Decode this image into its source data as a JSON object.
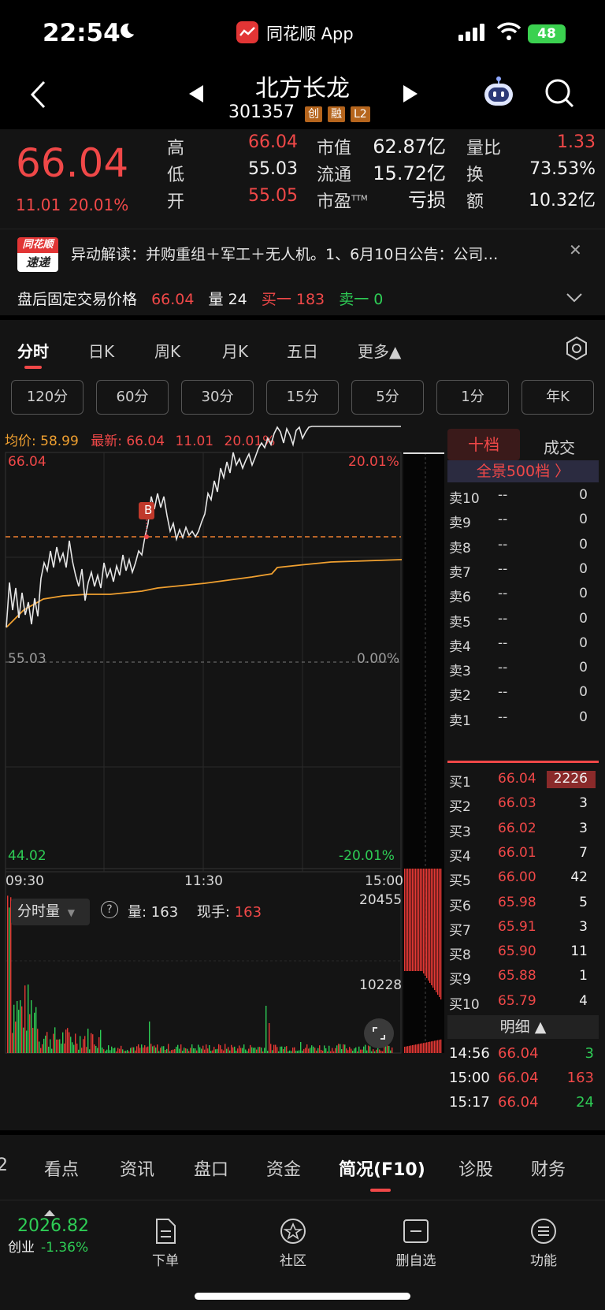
{
  "status": {
    "time": "22:54",
    "app": "同花顺 App",
    "battery": "48"
  },
  "nav": {
    "name": "北方长龙",
    "code": "301357",
    "tags": [
      "创",
      "融",
      "L2"
    ]
  },
  "quote": {
    "price": "66.04",
    "change": "11.01",
    "pct": "20.01%",
    "stats": [
      {
        "label": "高",
        "value": "66.04",
        "color": "#f04848"
      },
      {
        "label": "低",
        "value": "55.03",
        "color": "#e8e8e8"
      },
      {
        "label": "开",
        "value": "55.05",
        "color": "#f04848"
      },
      {
        "label": "市值",
        "value": "62.87亿",
        "color": "#e8e8e8"
      },
      {
        "label": "流通",
        "value": "15.72亿",
        "color": "#e8e8e8"
      },
      {
        "label": "市盈",
        "value": "亏损",
        "color": "#e8e8e8",
        "sup": "TTM"
      },
      {
        "label": "量比",
        "value": "1.33",
        "color": "#f04848"
      },
      {
        "label": "换",
        "value": "73.53%",
        "color": "#e8e8e8"
      },
      {
        "label": "额",
        "value": "10.32亿",
        "color": "#e8e8e8"
      }
    ]
  },
  "news": {
    "logo_top": "同花顺",
    "logo_bottom": "速递",
    "text": "异动解读：并购重组＋军工＋无人机。1、6月10日公告：公司…",
    "close": "✕",
    "post_label": "盘后固定交易价格",
    "post_price": "66.04",
    "vol_label": "量",
    "vol": "24",
    "buy_label": "买一",
    "buy": "183",
    "sell_label": "卖一",
    "sell": "0"
  },
  "tabs": [
    "分时",
    "日K",
    "周K",
    "月K",
    "五日",
    "更多▲"
  ],
  "periods": [
    "120分",
    "60分",
    "30分",
    "15分",
    "5分",
    "1分",
    "年K"
  ],
  "chart": {
    "avg_label": "均价: 58.99",
    "latest_label": "最新: 66.04",
    "latest_chg": "11.01",
    "latest_pct": "20.01%",
    "y_high": "66.04",
    "y_mid": "55.03",
    "y_low": "44.02",
    "p_high": "20.01%",
    "p_mid": "0.00%",
    "p_low": "-20.01%",
    "x_ticks": [
      "09:30",
      "11:30",
      "15:00"
    ],
    "buy_marker": "B",
    "vol_selector": "分时量",
    "vol_label": "量: ",
    "vol_value": "163",
    "hand_label": "现手: ",
    "hand_value": "163",
    "vol_max": "20455",
    "vol_mid": "10228"
  },
  "chart_data": {
    "type": "line",
    "x": [
      "09:30",
      "11:30",
      "15:00"
    ],
    "ylim": [
      44.02,
      66.04
    ],
    "series": []
  },
  "orderbook": {
    "tab_active": "十档",
    "tab_other": "成交",
    "all_link": "全景500档 〉",
    "sells": [
      {
        "label": "卖10",
        "price": "--",
        "vol": "0"
      },
      {
        "label": "卖9",
        "price": "--",
        "vol": "0"
      },
      {
        "label": "卖8",
        "price": "--",
        "vol": "0"
      },
      {
        "label": "卖7",
        "price": "--",
        "vol": "0"
      },
      {
        "label": "卖6",
        "price": "--",
        "vol": "0"
      },
      {
        "label": "卖5",
        "price": "--",
        "vol": "0"
      },
      {
        "label": "卖4",
        "price": "--",
        "vol": "0"
      },
      {
        "label": "卖3",
        "price": "--",
        "vol": "0"
      },
      {
        "label": "卖2",
        "price": "--",
        "vol": "0"
      },
      {
        "label": "卖1",
        "price": "--",
        "vol": "0"
      }
    ],
    "buys": [
      {
        "label": "买1",
        "price": "66.04",
        "vol": "2226"
      },
      {
        "label": "买2",
        "price": "66.03",
        "vol": "3"
      },
      {
        "label": "买3",
        "price": "66.02",
        "vol": "3"
      },
      {
        "label": "买4",
        "price": "66.01",
        "vol": "7"
      },
      {
        "label": "买5",
        "price": "66.00",
        "vol": "42"
      },
      {
        "label": "买6",
        "price": "65.98",
        "vol": "5"
      },
      {
        "label": "买7",
        "price": "65.91",
        "vol": "3"
      },
      {
        "label": "买8",
        "price": "65.90",
        "vol": "11"
      },
      {
        "label": "买9",
        "price": "65.88",
        "vol": "1"
      },
      {
        "label": "买10",
        "price": "65.79",
        "vol": "4"
      }
    ],
    "detail_label": "明细 ▲",
    "trades": [
      {
        "time": "14:56",
        "price": "66.04",
        "vol": "3",
        "color": "#2ecc55"
      },
      {
        "time": "15:00",
        "price": "66.04",
        "vol": "163",
        "color": "#f04848"
      },
      {
        "time": "15:17",
        "price": "66.04",
        "vol": "24",
        "color": "#2ecc55"
      }
    ]
  },
  "bottom_tabs": [
    "2",
    "看点",
    "资讯",
    "盘口",
    "资金",
    "简况(F10)",
    "诊股",
    "财务"
  ],
  "index": {
    "value": "2026.82",
    "name": "创业",
    "pct": "-1.36%"
  },
  "toolbar": [
    "下单",
    "社区",
    "删自选",
    "功能"
  ]
}
